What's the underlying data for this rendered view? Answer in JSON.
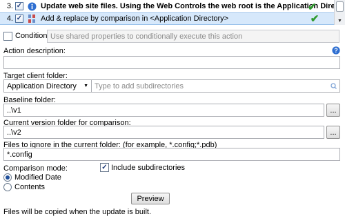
{
  "actions": [
    {
      "number": "3.",
      "checked": true,
      "icon": "info-icon",
      "title": "Update web site files. Using the Web Controls the web root is the Application Directory",
      "status": "success-check-icon"
    },
    {
      "number": "4.",
      "checked": true,
      "icon": "files-compare-icon",
      "title": "Add & replace by comparison in <Application Directory>",
      "status": "success-check-icon"
    }
  ],
  "condition": {
    "label": "Condition:",
    "placeholder": "Use shared properties to conditionally execute this action",
    "checked": false
  },
  "description": {
    "label": "Action description:",
    "value": ""
  },
  "target": {
    "label": "Target client folder:",
    "folder": "Application Directory",
    "subdir_placeholder": "Type to add subdirectories"
  },
  "baseline": {
    "label": "Baseline folder:",
    "value": "..\\v1",
    "browse": "..."
  },
  "current": {
    "label": "Current version folder for comparison:",
    "value": "..\\v2",
    "browse": "..."
  },
  "ignore": {
    "label": "Files to ignore in the current folder: (for example, *.config;*.pdb)",
    "value": "*.config"
  },
  "comparison": {
    "label": "Comparison mode:",
    "include_label": "Include subdirectories",
    "include_checked": true,
    "options": [
      {
        "label": "Modified Date",
        "selected": true
      },
      {
        "label": "Contents",
        "selected": false
      }
    ]
  },
  "preview_label": "Preview",
  "footer_text": "Files will be copied when the update is built.",
  "colors": {
    "selected_row": "#d6e8fb",
    "check_green": "#2e9a2e",
    "help_blue": "#2f6fd1"
  }
}
